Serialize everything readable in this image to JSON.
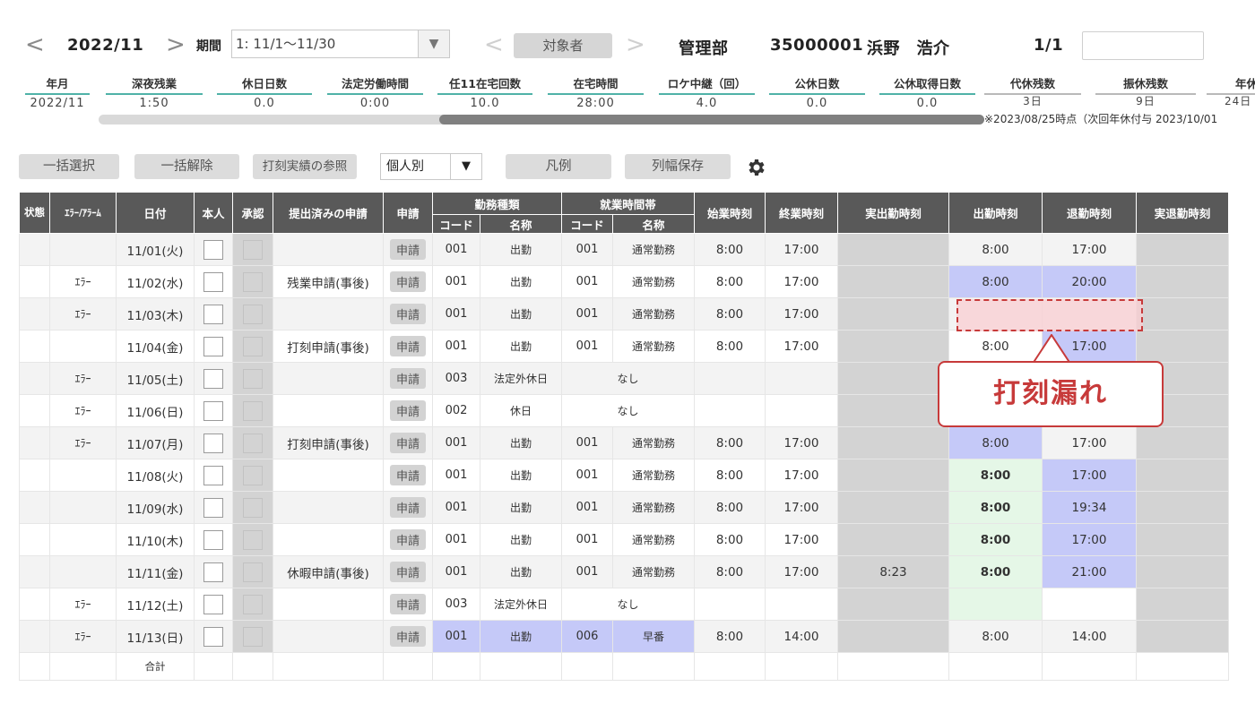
{
  "header": {
    "prev_arrow": "<",
    "year_month": "2022/11",
    "next_arrow": ">",
    "period_label": "期間",
    "period_value": "1: 11/1〜11/30",
    "target_prev": "<",
    "target_button": "対象者",
    "target_next": ">",
    "department": "管理部",
    "employee_id": "35000001",
    "employee_name": "浜野　浩介",
    "page": "1/1"
  },
  "summary": {
    "headers": [
      "年月",
      "深夜残業",
      "休日日数",
      "法定労働時間",
      "任11在宅回数",
      "在宅時間",
      "ロケ中継（回）",
      "公休日数",
      "公休取得日数",
      "代休残数",
      "振休残数",
      "年休"
    ],
    "values": [
      "2022/11",
      "1:50",
      "0.0",
      "0:00",
      "10.0",
      "28:00",
      "4.0",
      "0.0",
      "0.0",
      "3日",
      "9日",
      "24日"
    ],
    "note": "※2023/08/25時点（次回年休付与 2023/10/01"
  },
  "toolbar": {
    "select_all": "一括選択",
    "deselect_all": "一括解除",
    "clock_ref": "打刻実績の参照",
    "mode_value": "個人別",
    "legend": "凡例",
    "save_width": "列幅保存"
  },
  "table": {
    "headers": {
      "status": "状態",
      "error": "ｴﾗｰ/ｱﾗｰﾑ",
      "date": "日付",
      "self": "本人",
      "approve": "承認",
      "submitted": "提出済みの申請",
      "apply": "申請",
      "work_type": "勤務種類",
      "work_hours": "就業時間帯",
      "code": "コード",
      "name": "名称",
      "code2": "コード",
      "name2": "名称",
      "start": "始業時刻",
      "end": "終業時刻",
      "actual_in": "実出勤時刻",
      "clock_in": "出勤時刻",
      "clock_out": "退勤時刻",
      "actual_out": "実退勤時刻"
    },
    "apply_label": "申請",
    "total_label": "合計",
    "rows": [
      {
        "error": "",
        "date": "11/01(火)",
        "submitted": "",
        "wcode": "001",
        "wname": "出勤",
        "hcode": "001",
        "hname": "通常勤務",
        "start": "8:00",
        "end": "17:00",
        "actual_in": "",
        "clock_in": "8:00",
        "clock_out": "17:00"
      },
      {
        "error": "ｴﾗｰ",
        "date": "11/02(水)",
        "submitted": "残業申請(事後)",
        "wcode": "001",
        "wname": "出勤",
        "hcode": "001",
        "hname": "通常勤務",
        "start": "8:00",
        "end": "17:00",
        "actual_in": "",
        "clock_in": "8:00",
        "clock_out": "20:00"
      },
      {
        "error": "ｴﾗｰ",
        "date": "11/03(木)",
        "submitted": "",
        "wcode": "001",
        "wname": "出勤",
        "hcode": "001",
        "hname": "通常勤務",
        "start": "8:00",
        "end": "17:00",
        "actual_in": "",
        "clock_in": "",
        "clock_out": ""
      },
      {
        "error": "",
        "date": "11/04(金)",
        "submitted": "打刻申請(事後)",
        "wcode": "001",
        "wname": "出勤",
        "hcode": "001",
        "hname": "通常勤務",
        "start": "8:00",
        "end": "17:00",
        "actual_in": "",
        "clock_in": "8:00",
        "clock_out": "17:00"
      },
      {
        "error": "ｴﾗｰ",
        "date": "11/05(土)",
        "submitted": "",
        "wcode": "003",
        "wname": "法定外休日",
        "hcode": "",
        "hname": "なし",
        "start": "",
        "end": "",
        "actual_in": "",
        "clock_in": "",
        "clock_out": ""
      },
      {
        "error": "ｴﾗｰ",
        "date": "11/06(日)",
        "submitted": "",
        "wcode": "002",
        "wname": "休日",
        "hcode": "",
        "hname": "なし",
        "start": "",
        "end": "",
        "actual_in": "",
        "clock_in": "",
        "clock_out": ""
      },
      {
        "error": "ｴﾗｰ",
        "date": "11/07(月)",
        "submitted": "打刻申請(事後)",
        "wcode": "001",
        "wname": "出勤",
        "hcode": "001",
        "hname": "通常勤務",
        "start": "8:00",
        "end": "17:00",
        "actual_in": "",
        "clock_in": "8:00",
        "clock_out": "17:00"
      },
      {
        "error": "",
        "date": "11/08(火)",
        "submitted": "",
        "wcode": "001",
        "wname": "出勤",
        "hcode": "001",
        "hname": "通常勤務",
        "start": "8:00",
        "end": "17:00",
        "actual_in": "",
        "clock_in": "8:00",
        "clock_out": "17:00"
      },
      {
        "error": "",
        "date": "11/09(水)",
        "submitted": "",
        "wcode": "001",
        "wname": "出勤",
        "hcode": "001",
        "hname": "通常勤務",
        "start": "8:00",
        "end": "17:00",
        "actual_in": "",
        "clock_in": "8:00",
        "clock_out": "19:34"
      },
      {
        "error": "",
        "date": "11/10(木)",
        "submitted": "",
        "wcode": "001",
        "wname": "出勤",
        "hcode": "001",
        "hname": "通常勤務",
        "start": "8:00",
        "end": "17:00",
        "actual_in": "",
        "clock_in": "8:00",
        "clock_out": "17:00"
      },
      {
        "error": "",
        "date": "11/11(金)",
        "submitted": "休暇申請(事後)",
        "wcode": "001",
        "wname": "出勤",
        "hcode": "001",
        "hname": "通常勤務",
        "start": "8:00",
        "end": "17:00",
        "actual_in": "8:23",
        "clock_in": "8:00",
        "clock_out": "21:00"
      },
      {
        "error": "ｴﾗｰ",
        "date": "11/12(土)",
        "submitted": "",
        "wcode": "003",
        "wname": "法定外休日",
        "hcode": "",
        "hname": "なし",
        "start": "",
        "end": "",
        "actual_in": "",
        "clock_in": "",
        "clock_out": ""
      },
      {
        "error": "ｴﾗｰ",
        "date": "11/13(日)",
        "submitted": "",
        "wcode": "001",
        "wname": "出勤",
        "hcode": "006",
        "hname": "早番",
        "start": "8:00",
        "end": "14:00",
        "actual_in": "",
        "clock_in": "8:00",
        "clock_out": "14:00"
      }
    ]
  },
  "callout": {
    "text": "打刻漏れ"
  },
  "colors": {
    "accent_teal": "#4fb2a8",
    "header_gray": "#595959",
    "blue_cell": "#c5c9f8",
    "error_red": "#c73a3a",
    "saturday": "#2a73c8",
    "sunday": "#e0393b",
    "green": "#2eb12e"
  }
}
